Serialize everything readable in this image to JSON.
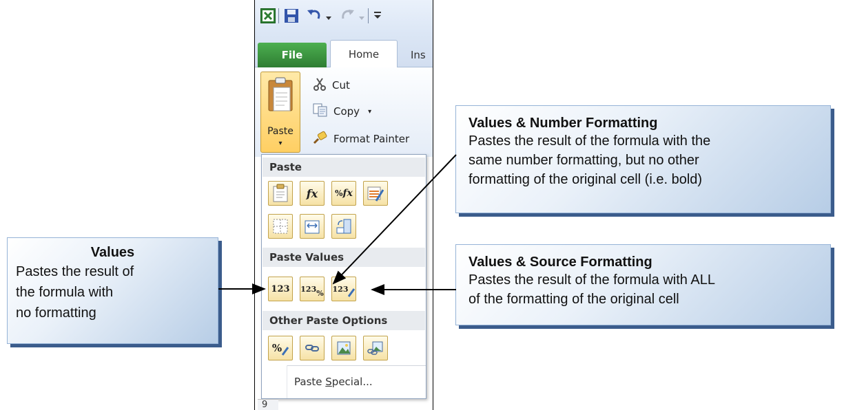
{
  "ribbon": {
    "tabs": {
      "file": "File",
      "home": "Home",
      "insert": "Ins"
    },
    "clipboard": {
      "paste_label": "Paste",
      "paste_arrow": "▾",
      "cut": "Cut",
      "copy": "Copy",
      "copy_arrow": "▾",
      "format_painter": "Format Painter"
    }
  },
  "paste_menu": {
    "section_paste": "Paste",
    "section_paste_values": "Paste Values",
    "section_other": "Other Paste Options",
    "paste_special_prefix": "Paste ",
    "paste_special_accel": "S",
    "paste_special_suffix": "pecial...",
    "value_icon_text": "123",
    "percent_icon_text": "%",
    "fx_icon_text": "fx"
  },
  "row_header": "9",
  "callouts": {
    "values": {
      "title": "Values",
      "lines": [
        "Pastes the result of",
        "the formula with",
        "no formatting"
      ]
    },
    "values_number_formatting": {
      "title": "Values & Number Formatting",
      "lines": [
        "Pastes the result of the formula with the",
        "same number formatting, but no other",
        "formatting of the original cell (i.e. bold)"
      ]
    },
    "values_source_formatting": {
      "title": "Values & Source Formatting",
      "lines": [
        "Pastes the result of the formula with ALL",
        "of the formatting of the original cell"
      ]
    }
  },
  "colors": {
    "file_tab": "#2e7d32",
    "paste_highlight": "#ffcf63",
    "callout_shadow": "#3b5c8c"
  }
}
